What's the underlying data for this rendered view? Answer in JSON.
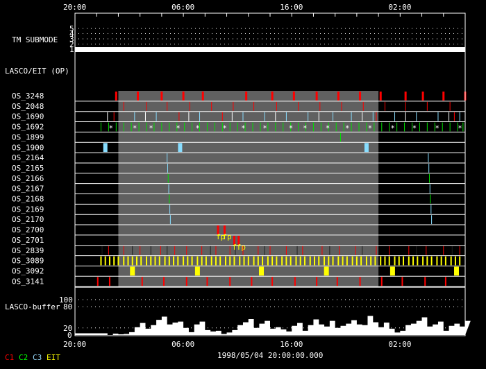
{
  "chart_data": {
    "type": "timeline",
    "time_ticks": [
      "20:00",
      "06:00",
      "16:00",
      "02:00"
    ],
    "time_tick_hours": [
      0,
      10,
      20,
      30
    ],
    "time_range_hours": [
      0,
      36
    ],
    "date_label": "1998/05/04 20:00:00.000",
    "tm_submode": {
      "label": "TM SUBMODE",
      "levels": [
        "1",
        "2",
        "3",
        "4",
        "5"
      ],
      "value": 1
    },
    "section_label": "LASCO/EIT (OP)",
    "gray_period_hours": [
      4.0,
      28.0
    ],
    "rows": [
      {
        "name": "OS_3248",
        "events": [
          {
            "c": "C1",
            "w": 3,
            "t": [
              3.8,
              5.8,
              8.0,
              10.0,
              11.8,
              15.8,
              18.2,
              20.2,
              22.3,
              24.3,
              26.3,
              28.2,
              30.5,
              32.1,
              34.0,
              36.0
            ]
          }
        ]
      },
      {
        "name": "OS_2048",
        "events": [
          {
            "c": "C1",
            "w": 1,
            "t": [
              4.5,
              6.6,
              8.5,
              10.6,
              12.6,
              14.6,
              16.5,
              18.6,
              20.6,
              22.6,
              24.6,
              26.6,
              28.6,
              30.5,
              32.5,
              34.6
            ]
          }
        ]
      },
      {
        "name": "OS_1690",
        "events": [
          {
            "c": "C3",
            "w": 1,
            "t": [
              5.5,
              7.5,
              11.5,
              15.5,
              17.5,
              19.5,
              21.5,
              23.8,
              25.5,
              27.5,
              29.5,
              31.5,
              33.5,
              35.5
            ]
          },
          {
            "c": "C1",
            "w": 1,
            "t": [
              3.6,
              9.6,
              13.6,
              27.8,
              35.0
            ]
          },
          {
            "c": "W",
            "w": 1,
            "t": [
              3.0,
              6.5,
              10.5,
              14.5,
              18.5,
              22.5,
              26.5,
              30.5,
              34.5
            ]
          }
        ]
      },
      {
        "name": "OS_1692",
        "events": [
          {
            "c": "C2",
            "w": 1,
            "t": [
              2.4,
              3.1,
              3.8,
              4.5,
              5.2,
              5.9,
              6.6,
              7.3,
              8.0,
              8.7,
              9.4,
              10.1,
              10.8,
              11.5,
              12.2,
              12.9,
              13.6,
              14.3,
              15.0,
              15.7,
              16.4,
              17.1,
              17.8,
              18.5,
              19.2,
              19.9,
              20.6,
              21.3,
              22.0,
              22.7,
              23.4,
              24.1,
              24.8,
              25.5,
              26.2,
              26.9,
              27.6,
              28.3,
              29.0,
              29.7,
              30.4,
              31.1,
              31.8,
              32.5,
              33.2,
              33.9,
              34.6,
              35.3,
              35.8
            ]
          }
        ],
        "stars": [
          3.3,
          5.5,
          7.0,
          9.5,
          11.3,
          13.8,
          15.5,
          17.5,
          19.9,
          21.2,
          23.3,
          25.1,
          27.2,
          29.3,
          31.3,
          33.4,
          35.5
        ]
      },
      {
        "name": "OS_1899",
        "events": [
          {
            "c": "C2",
            "w": 1,
            "t": [
              24.5
            ]
          }
        ]
      },
      {
        "name": "OS_1900",
        "events": [
          {
            "c": "C3",
            "w": 6,
            "t": [
              2.8,
              9.7,
              26.9
            ]
          }
        ]
      },
      {
        "name": "OS_2164",
        "events": [
          {
            "c": "C3",
            "w": 1,
            "t": [
              8.5,
              32.6
            ]
          }
        ]
      },
      {
        "name": "OS_2165",
        "events": [
          {
            "c": "C3",
            "w": 1,
            "t": [
              8.55,
              32.65
            ]
          }
        ]
      },
      {
        "name": "OS_2166",
        "events": [
          {
            "c": "C2",
            "w": 1,
            "t": [
              8.6,
              32.7
            ]
          }
        ]
      },
      {
        "name": "OS_2167",
        "events": [
          {
            "c": "C3",
            "w": 1,
            "t": [
              8.65,
              32.75
            ]
          }
        ]
      },
      {
        "name": "OS_2168",
        "events": [
          {
            "c": "C2",
            "w": 1,
            "t": [
              8.7,
              32.8
            ]
          }
        ]
      },
      {
        "name": "OS_2169",
        "events": [
          {
            "c": "C3",
            "w": 1,
            "t": [
              8.75,
              32.85
            ]
          }
        ]
      },
      {
        "name": "OS_2170",
        "events": [
          {
            "c": "C3",
            "w": 1,
            "t": [
              8.8,
              32.9
            ]
          }
        ]
      },
      {
        "name": "OS_2700",
        "events": [
          {
            "c": "C1",
            "w": 3,
            "t": [
              13.2,
              13.8
            ]
          }
        ],
        "labels": [
          "fp",
          "fp"
        ]
      },
      {
        "name": "OS_2701",
        "events": [
          {
            "c": "C1",
            "w": 3,
            "t": [
              14.7,
              15.1
            ]
          }
        ],
        "labels": [
          "f",
          "fp"
        ]
      },
      {
        "name": "OS_2839",
        "events": [
          {
            "c": "C1",
            "w": 1,
            "t": [
              3.1,
              4.5,
              6.0,
              7.9,
              9.2,
              10.3,
              11.7,
              13.0,
              14.3,
              15.5,
              16.9,
              18.0,
              19.5,
              21.0,
              22.8,
              24.4,
              25.9,
              27.8,
              29.0,
              30.8,
              32.4,
              34.0,
              35.5
            ]
          },
          {
            "c": "D",
            "w": 1,
            "t": [
              2.5,
              4.0,
              5.3,
              7.0,
              8.5,
              12.5,
              14.8,
              17.5,
              20.5,
              23.5,
              26.5,
              31.5,
              34.8
            ]
          }
        ]
      },
      {
        "name": "OS_3089",
        "events": [
          {
            "c": "EIT",
            "w": 2,
            "t": [
              2.4,
              2.8,
              3.2,
              3.6,
              4.0,
              4.5,
              4.9,
              5.3,
              5.7,
              6.1,
              6.6,
              7.0,
              7.4,
              7.8,
              8.3,
              8.7,
              9.1,
              9.5,
              10.0,
              10.4,
              10.8,
              11.3,
              11.7,
              12.1,
              12.6,
              13.0,
              13.4,
              13.9,
              14.3,
              14.7,
              15.2,
              15.6,
              16.0,
              16.5,
              16.9,
              17.3,
              17.8,
              18.2,
              18.6,
              19.1,
              19.5,
              19.9,
              20.4,
              20.8,
              21.2,
              21.7,
              22.1,
              22.5,
              23.0,
              23.4,
              23.8,
              24.3,
              24.7,
              25.1,
              25.6,
              26.0,
              26.4,
              26.9,
              27.3,
              27.7,
              28.2,
              28.6,
              29.0,
              29.5,
              29.9,
              30.3,
              30.8,
              31.2,
              31.6,
              32.1,
              32.5,
              32.9,
              33.4,
              33.8,
              34.2,
              34.7,
              35.1,
              35.5
            ]
          }
        ]
      },
      {
        "name": "OS_3092",
        "events": [
          {
            "c": "EIT",
            "w": 7,
            "t": [
              5.3,
              11.3,
              17.2,
              23.2,
              29.3,
              35.2
            ]
          }
        ]
      },
      {
        "name": "OS_3141",
        "events": [
          {
            "c": "C1",
            "w": 2,
            "t": [
              2.1,
              3.2,
              6.2,
              8.2,
              10.3,
              12.2,
              14.3,
              16.3,
              18.2,
              20.3,
              22.3,
              24.2,
              26.3,
              28.3,
              30.2,
              32.3,
              34.2
            ]
          }
        ]
      }
    ],
    "buffer": {
      "label": "LASCO-buffer",
      "yticks": [
        "0",
        "20",
        "80",
        "100"
      ],
      "ytick_values": [
        0,
        20,
        80,
        100
      ],
      "ylim": [
        0,
        100
      ],
      "step_hours": 0.5,
      "values": [
        5,
        5,
        5,
        5,
        5,
        5,
        0,
        4,
        2,
        3,
        8,
        22,
        34,
        18,
        28,
        43,
        52,
        30,
        35,
        38,
        20,
        8,
        30,
        38,
        14,
        10,
        12,
        3,
        7,
        14,
        28,
        36,
        45,
        20,
        32,
        40,
        18,
        22,
        16,
        10,
        26,
        34,
        12,
        28,
        44,
        30,
        24,
        40,
        20,
        26,
        32,
        42,
        30,
        28,
        54,
        36,
        22,
        35,
        18,
        7,
        12,
        28,
        32,
        40,
        50,
        24,
        30,
        38,
        12,
        26,
        32,
        24,
        40
      ]
    },
    "legend": [
      {
        "label": "C1",
        "color": "#ff0000"
      },
      {
        "label": "C2",
        "color": "#00ff00"
      },
      {
        "label": "C3",
        "color": "#99ddff"
      },
      {
        "label": "EIT",
        "color": "#ffff00"
      }
    ]
  }
}
